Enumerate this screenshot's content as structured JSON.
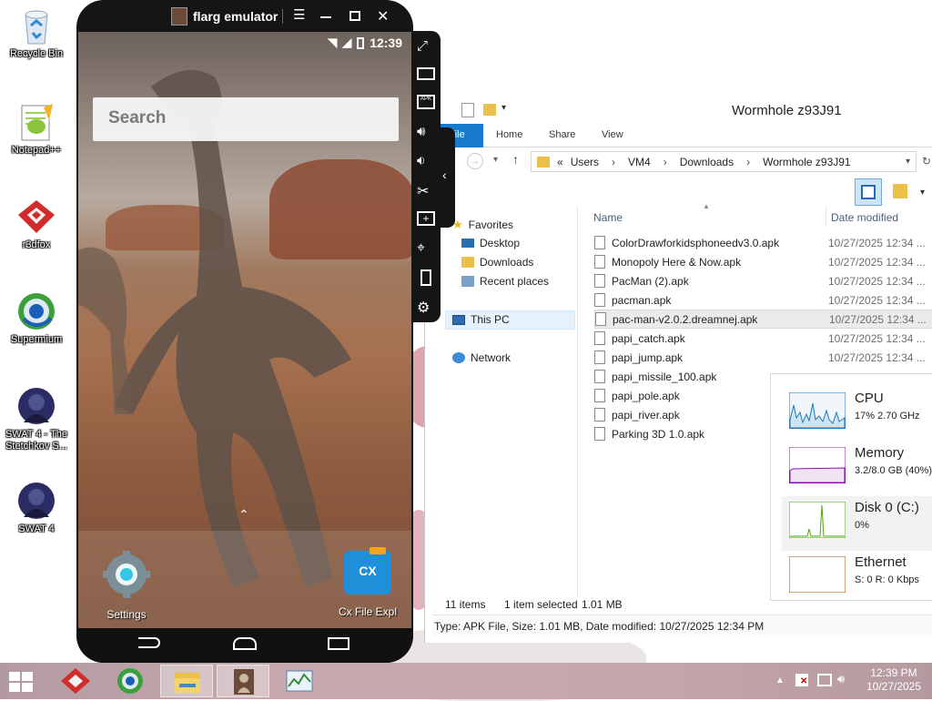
{
  "desktop": {
    "icons": [
      {
        "label": "Recycle Bin",
        "icon": "recycle-bin-icon"
      },
      {
        "label": "Notepad++",
        "icon": "notepad-plus-plus-icon"
      },
      {
        "label": "r3dfox",
        "icon": "r3dfox-icon"
      },
      {
        "label": "Supermium",
        "icon": "supermium-icon"
      },
      {
        "label": "SWAT 4 - The Stetchkov S...",
        "icon": "swat4-expansion-icon"
      },
      {
        "label": "SWAT 4",
        "icon": "swat4-icon"
      }
    ]
  },
  "emulator": {
    "title": "flarg emulator",
    "status_time": "12:39",
    "search_placeholder": "Search",
    "dock": {
      "settings_label": "Settings",
      "cx_label": "Cx File Expl",
      "cx_icon_text": "CX"
    },
    "toolbar_icons": [
      "fullscreen-icon",
      "keyboard-icon",
      "apk-install-icon",
      "volume-up-icon",
      "volume-down-icon",
      "screenshot-cut-icon",
      "add-window-icon",
      "location-icon",
      "shake-icon",
      "settings-icon"
    ]
  },
  "explorer": {
    "title": "Wormhole z93J91",
    "ribbon_tabs": [
      "File",
      "Home",
      "Share",
      "View"
    ],
    "breadcrumb": [
      "«",
      "Users",
      "VM4",
      "Downloads",
      "Wormhole z93J91"
    ],
    "nav_pane": {
      "favorites": "Favorites",
      "desktop": "Desktop",
      "downloads": "Downloads",
      "recent": "Recent places",
      "this_pc": "This PC",
      "network": "Network"
    },
    "columns": {
      "name": "Name",
      "date": "Date modified"
    },
    "files": [
      {
        "name": "ColorDrawforkidsphoneedv3.0.apk",
        "date": "10/27/2025 12:34 ..."
      },
      {
        "name": "Monopoly Here & Now.apk",
        "date": "10/27/2025 12:34 ..."
      },
      {
        "name": "PacMan (2).apk",
        "date": "10/27/2025 12:34 ..."
      },
      {
        "name": "pacman.apk",
        "date": "10/27/2025 12:34 ..."
      },
      {
        "name": "pac-man-v2.0.2.dreamnej.apk",
        "date": "10/27/2025 12:34 ..."
      },
      {
        "name": "papi_catch.apk",
        "date": "10/27/2025 12:34 ..."
      },
      {
        "name": "papi_jump.apk",
        "date": "10/27/2025 12:34 ..."
      },
      {
        "name": "papi_missile_100.apk",
        "date": ""
      },
      {
        "name": "papi_pole.apk",
        "date": ""
      },
      {
        "name": "papi_river.apk",
        "date": ""
      },
      {
        "name": "Parking 3D 1.0.apk",
        "date": ""
      }
    ],
    "selected_index": 4,
    "status": {
      "count": "11 items",
      "selected": "1 item selected",
      "size": "1.01 MB"
    },
    "details": "Type: APK File, Size: 1.01 MB, Date modified: 10/27/2025 12:34 PM"
  },
  "performance": {
    "items": [
      {
        "title": "CPU",
        "sub": "17%  2.70 GHz",
        "color": "#1c7bc0"
      },
      {
        "title": "Memory",
        "sub": "3.2/8.0 GB (40%)",
        "color": "#8b12ae"
      },
      {
        "title": "Disk 0 (C:)",
        "sub": "0%",
        "color": "#4da60c"
      },
      {
        "title": "Ethernet",
        "sub": "S: 0  R: 0 Kbps",
        "color": "#a74f01"
      }
    ]
  },
  "taskbar": {
    "apps": [
      "r3dfox-icon",
      "supermium-icon",
      "file-explorer-icon",
      "flarg-emulator-icon",
      "task-manager-icon"
    ],
    "clock_time": "12:39 PM",
    "clock_date": "10/27/2025"
  }
}
